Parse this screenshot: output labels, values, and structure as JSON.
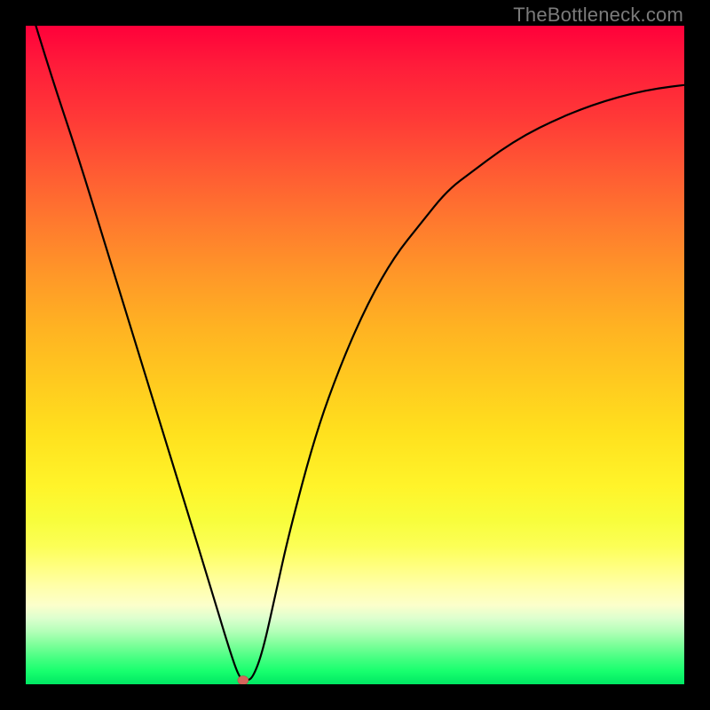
{
  "watermark": "TheBottleneck.com",
  "chart_data": {
    "type": "line",
    "title": "",
    "xlabel": "",
    "ylabel": "",
    "xlim": [
      0,
      100
    ],
    "ylim": [
      0,
      100
    ],
    "grid": false,
    "series": [
      {
        "name": "curve",
        "x": [
          0,
          4,
          8,
          12,
          16,
          20,
          24,
          28,
          31,
          32.5,
          33.5,
          34.5,
          36,
          38,
          40,
          44,
          48,
          52,
          56,
          60,
          64,
          68,
          72,
          76,
          80,
          84,
          88,
          92,
          96,
          100
        ],
        "y": [
          105,
          92,
          80,
          67,
          54,
          41,
          28,
          15,
          5,
          0.8,
          0.5,
          1.0,
          5,
          14,
          23,
          38,
          49,
          58,
          65,
          70,
          75,
          78,
          81,
          83.5,
          85.5,
          87.2,
          88.6,
          89.7,
          90.5,
          91
        ]
      }
    ],
    "marker": {
      "x": 33,
      "y": 0.6,
      "role": "min-point"
    },
    "background": {
      "type": "gradient",
      "stops": [
        {
          "pos": 0.0,
          "color": "#ff003a"
        },
        {
          "pos": 0.3,
          "color": "#ff7a2e"
        },
        {
          "pos": 0.62,
          "color": "#ffe11e"
        },
        {
          "pos": 0.85,
          "color": "#ffffa8"
        },
        {
          "pos": 1.0,
          "color": "#00e763"
        }
      ]
    }
  }
}
